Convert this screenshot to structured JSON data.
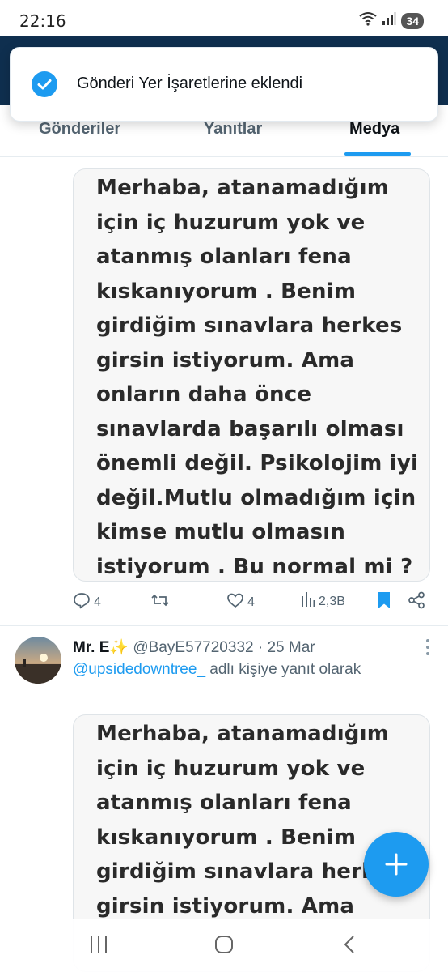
{
  "status_bar": {
    "time": "22:16",
    "battery": "34"
  },
  "toast": {
    "message": "Gönderi Yer İşaretlerine eklendi"
  },
  "tabs": [
    {
      "label": "Gönderiler",
      "active": false
    },
    {
      "label": "Yanıtlar",
      "active": false
    },
    {
      "label": "Medya",
      "active": true
    }
  ],
  "tweet1": {
    "media_text": "Merhaba, atanamadığım için iç huzurum yok ve atanmış olanları fena kıskanıyorum . Benim girdiğim sınavlara herkes girsin istiyorum. Ama onların daha önce sınavlarda başarılı olması önemli değil. Psikolojim iyi değil.Mutlu olmadığım için kimse mutlu olmasın istiyorum . Bu normal mi ?",
    "replies": "4",
    "likes": "4",
    "views": "2,3B"
  },
  "tweet2": {
    "name": "Mr. E✨",
    "handle": "@BayE57720332",
    "separator": "·",
    "date": "25 Mar",
    "reply_to_mention": "@upsidedowntree_",
    "reply_to_suffix": " adlı kişiye yanıt olarak",
    "media_text": "Merhaba, atanamadığım için iç huzurum yok ve atanmış olanları fena kıskanıyorum . Benim girdiğim sınavlara herkes girsin istiyorum. Ama"
  },
  "colors": {
    "accent": "#1d9bf0",
    "header": "#0f2f4f",
    "muted": "#536471"
  },
  "icons": [
    "wifi-icon",
    "signal-icon",
    "check-circle-icon",
    "reply-icon",
    "retweet-icon",
    "like-icon",
    "views-icon",
    "bookmark-icon",
    "share-icon",
    "more-icon",
    "compose-icon",
    "nav-recent-icon",
    "nav-home-icon",
    "nav-back-icon"
  ]
}
